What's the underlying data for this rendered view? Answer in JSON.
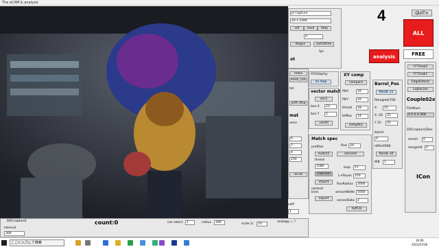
{
  "window": {
    "title": "The eCAM & analysis"
  },
  "counter": {
    "value": "4",
    "quit": "QUIT×"
  },
  "buttons": {
    "all_stop": "ALL STOP",
    "analysis": "analysis",
    "free": "FREE"
  },
  "capture": {
    "device": "pi Capture",
    "resolution": "20 x 1080",
    "set": "set",
    "save": "save",
    "stop": "Stop",
    "zero": "0",
    "bogus": "Bogus",
    "cam2time": "cam2time",
    "fps": "fps",
    "zoom": "ot"
  },
  "left_stubs": [
    "meta",
    "meta_calc",
    "tet",
    "ynth disp",
    "mat",
    "ence"
  ],
  "stub_values": [
    "6",
    "7",
    "4",
    "250"
  ],
  "stub_all": "ze-all",
  "xy": {
    "title": "XY2display",
    "no_loop": "no loop"
  },
  "vector_match": {
    "title": "vector match",
    "voc": "voc1",
    "box_x": "box X",
    "box_x_val": "23",
    "box_y": "box Y",
    "box_y_val": "5",
    "vecall": "vecAll"
  },
  "xy_comp": {
    "title": "XY comp",
    "compara": "compara",
    "filtx": "filtX",
    "filtx_val": "10",
    "filty": "filtY",
    "filty_val": "10",
    "thresh": "thresh",
    "thresh_val": "18",
    "thmax": "thMax",
    "thmax_val": "14",
    "compall": "compALL"
  },
  "barrel": {
    "title": "Barrel_Pos",
    "randl": "RandL x1",
    "rtangled": "Rtangled(700",
    "x": "X",
    "x_val": "25",
    "xo": "X -20",
    "xo_val": "25",
    "y": "Y 25",
    "y_val": "25",
    "barrel": "barrel",
    "barrel_val": "0",
    "differ": "differ0568",
    "randl2": "RandL x0",
    "wb": "WB",
    "wb_val": "1"
  },
  "right_col": {
    "items": [
      "FFTmak2",
      "FFTmak1",
      "EdgeDetect",
      "Laplacian"
    ],
    "couple": "Couple02x",
    "filmnum_label": "FilmNum",
    "filmnum": "0 0 0 0 268",
    "capture_dev": "D]ICcapture[Dev",
    "minim": "minim",
    "minim_val": "0",
    "merge": "mergeAlt",
    "merge_val": "0",
    "icon": "ICon"
  },
  "match_spec": {
    "title": "Match spec",
    "find": "find",
    "find_val": "20",
    "profiltar": "profiltar",
    "connect": "connect",
    "match1": "match1",
    "thresh": "thresh",
    "val_1080": "1080",
    "loop": "loop",
    "loop_val": "57",
    "matchall": "matchall",
    "lrays": "L+Reyos",
    "lrays_val": "250",
    "import": "import",
    "runradius": "RunRadius",
    "runradius_val": "2000",
    "content_lines": "content lines",
    "sensorwidth": "sensorWidth",
    "sensorwidth_val": "5000",
    "export": "export",
    "sensordata": "sensorData",
    "sensordata_val": "2",
    "topcd": "toPCD"
  },
  "bottom": {
    "capture_label": "D]ICcapture[",
    "interval_label": "Interval",
    "interval": "300",
    "count": "count:0",
    "cos_select": "cos select",
    "cos_val": "1",
    "radius": "radius",
    "radius_val": "300",
    "scale": "scale 1/",
    "scale_val": "10",
    "ckip": "ckIP",
    "ckip_val": "1",
    "analogy": "analogy = ?"
  },
  "taskbar": {
    "search": "ここに入力して検索",
    "time": "16:06",
    "date": "2022/07/28"
  },
  "colors": {
    "red": "#e81c1c",
    "blue_sel": "#cfe3f7",
    "stop_text": "#ffffff"
  }
}
